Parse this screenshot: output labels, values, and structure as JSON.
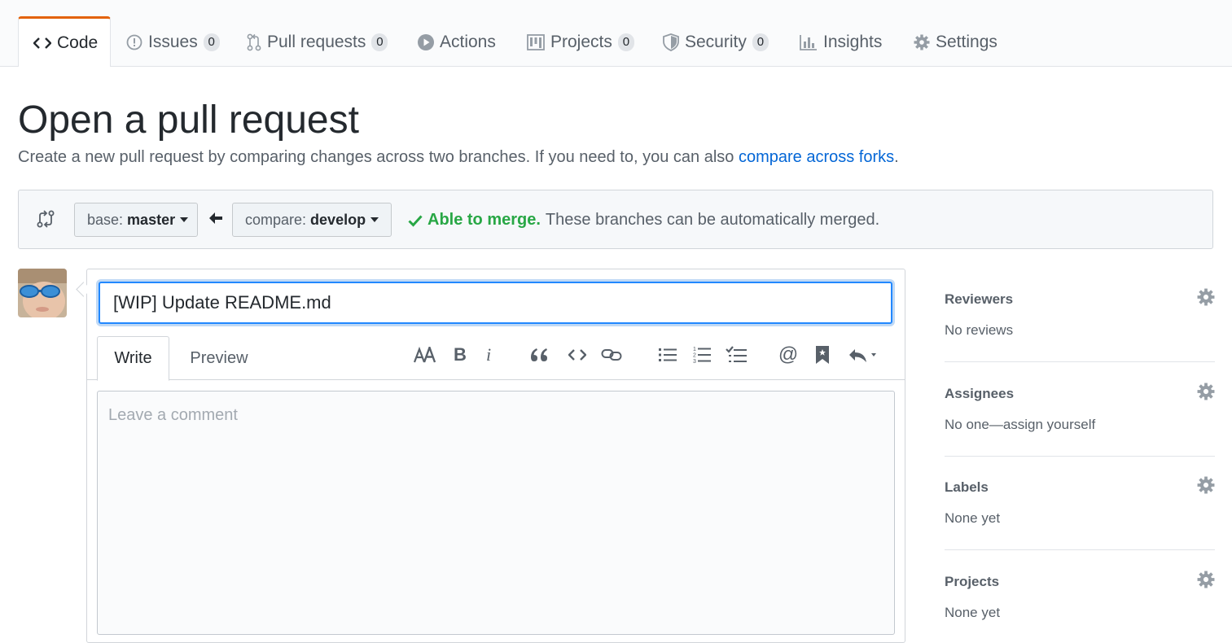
{
  "repo_nav": {
    "tabs": [
      {
        "label": "Code",
        "icon": "code-icon",
        "selected": true
      },
      {
        "label": "Issues",
        "icon": "issue-opened-icon",
        "count": "0"
      },
      {
        "label": "Pull requests",
        "icon": "git-pull-request-icon",
        "count": "0"
      },
      {
        "label": "Actions",
        "icon": "play-icon"
      },
      {
        "label": "Projects",
        "icon": "project-icon",
        "count": "0"
      },
      {
        "label": "Security",
        "icon": "shield-icon",
        "count": "0"
      },
      {
        "label": "Insights",
        "icon": "graph-icon"
      },
      {
        "label": "Settings",
        "icon": "gear-icon"
      }
    ]
  },
  "page": {
    "title": "Open a pull request",
    "subtitle": "Create a new pull request by comparing changes across two branches. If you need to, you can also ",
    "subtitle_link": "compare across forks",
    "subtitle_end": "."
  },
  "range": {
    "base_label": "base:",
    "base_value": "master",
    "compare_label": "compare:",
    "compare_value": "develop",
    "merge_status": "Able to merge.",
    "merge_message": "These branches can be automatically merged."
  },
  "composer": {
    "title_value": "[WIP] Update README.md",
    "write_tab": "Write",
    "preview_tab": "Preview",
    "comment_placeholder": "Leave a comment",
    "toolbar": [
      "text-size-icon",
      "bold-icon",
      "italic-icon",
      "quote-icon",
      "code-icon",
      "link-icon",
      "unordered-list-icon",
      "ordered-list-icon",
      "task-list-icon",
      "mention-icon",
      "bookmark-icon",
      "reply-icon"
    ]
  },
  "sidebar": {
    "reviewers": {
      "heading": "Reviewers",
      "value": "No reviews"
    },
    "assignees": {
      "heading": "Assignees",
      "value": "No one—assign yourself"
    },
    "labels": {
      "heading": "Labels",
      "value": "None yet"
    },
    "projects": {
      "heading": "Projects",
      "value": "None yet"
    }
  },
  "colors": {
    "accent_tab": "#e36209",
    "link": "#0366d6",
    "success": "#28a745",
    "focus": "#2188ff"
  }
}
